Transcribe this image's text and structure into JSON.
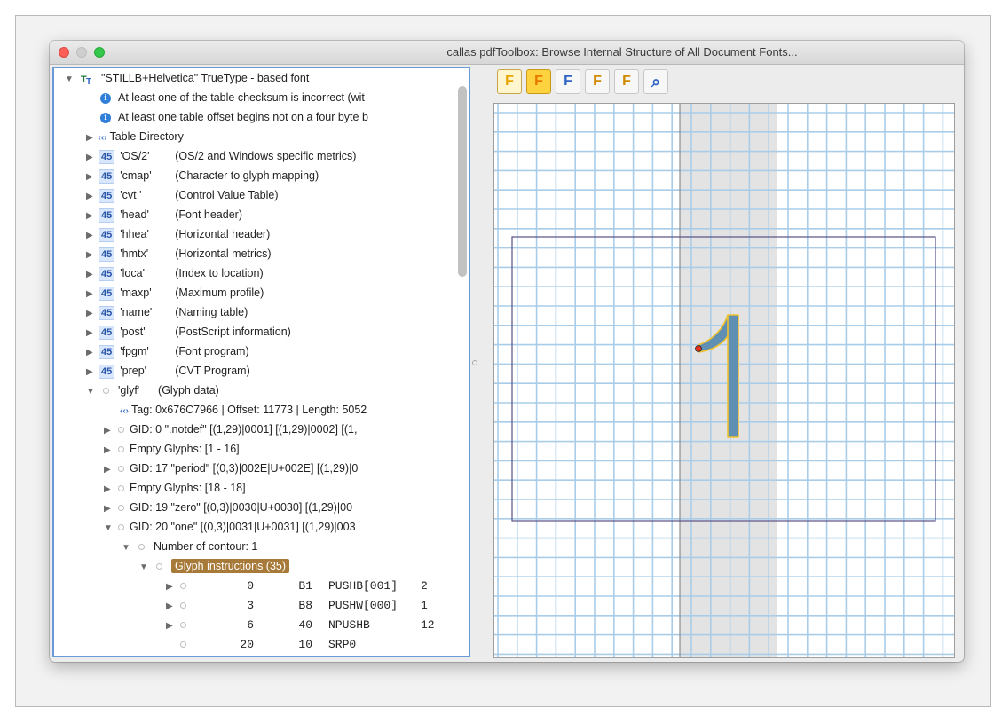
{
  "window": {
    "title": "callas pdfToolbox: Browse Internal Structure of All Document Fonts..."
  },
  "tree": {
    "root_label": "\"STILLB+Helvetica\"  TrueType - based font",
    "warnings": [
      "At least one of the table checksum is incorrect (wit",
      "At least one table offset begins not on a four byte b"
    ],
    "table_directory": "Table Directory",
    "badge": "45",
    "tables": [
      {
        "tag": "'OS/2'",
        "desc": "(OS/2 and Windows specific metrics)"
      },
      {
        "tag": "'cmap'",
        "desc": "(Character to glyph mapping)"
      },
      {
        "tag": "'cvt '",
        "desc": "(Control Value Table)"
      },
      {
        "tag": "'head'",
        "desc": "(Font header)"
      },
      {
        "tag": "'hhea'",
        "desc": "(Horizontal header)"
      },
      {
        "tag": "'hmtx'",
        "desc": "(Horizontal metrics)"
      },
      {
        "tag": "'loca'",
        "desc": "(Index to location)"
      },
      {
        "tag": "'maxp'",
        "desc": "(Maximum profile)"
      },
      {
        "tag": "'name'",
        "desc": "(Naming table)"
      },
      {
        "tag": "'post'",
        "desc": "(PostScript information)"
      },
      {
        "tag": "'fpgm'",
        "desc": "(Font program)"
      },
      {
        "tag": "'prep'",
        "desc": "(CVT Program)"
      }
    ],
    "glyf": {
      "tag": "'glyf'",
      "desc": "(Glyph data)"
    },
    "glyf_tag_line": "Tag: 0x676C7966 | Offset: 11773 | Length: 5052",
    "glyph_items": [
      "GID: 0  \".notdef\" [(1,29)|0001] [(1,29)|0002] [(1,",
      "Empty Glyphs: [1 - 16]",
      "GID: 17  \"period\" [(0,3)|002E|U+002E] [(1,29)|0",
      "Empty Glyphs: [18 - 18]",
      "GID: 19  \"zero\" [(0,3)|0030|U+0030] [(1,29)|00",
      "GID: 20  \"one\" [(0,3)|0031|U+0031] [(1,29)|003"
    ],
    "contours": "Number of contour: 1",
    "instructions_label": "Glyph instructions (35)",
    "instructions": [
      {
        "offset": "0",
        "op": "B1",
        "name": "PUSHB[001]",
        "arg": "2"
      },
      {
        "offset": "3",
        "op": "B8",
        "name": "PUSHW[000]",
        "arg": "1"
      },
      {
        "offset": "6",
        "op": "40",
        "name": "NPUSHB",
        "arg": "12"
      },
      {
        "offset": "20",
        "op": "10",
        "name": "SRP0",
        "arg": ""
      }
    ]
  },
  "toolbar": {
    "icons": [
      "glyph-points-icon",
      "glyph-outline-icon",
      "glyph-plain-icon",
      "glyph-hinted-icon",
      "glyph-grid-icon",
      "zoom-icon"
    ],
    "letter": "F"
  },
  "viewer": {
    "glyph_char": "1",
    "glyph_color": "#5f8fb3",
    "grid_color": "#a9cde9",
    "box_color": "#5a4f86"
  }
}
